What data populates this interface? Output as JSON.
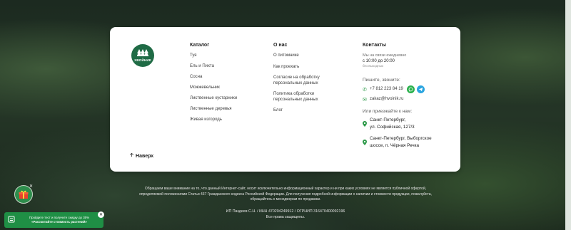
{
  "logo": {
    "text": "ХВОЙНИК",
    "color": "#1f6b45"
  },
  "catalog": {
    "title": "Каталог",
    "items": [
      "Туя",
      "Ель и Пихта",
      "Сосна",
      "Можжевельник",
      "Лиственные кустарники",
      "Лиственные деревья",
      "Живая изгородь"
    ]
  },
  "about": {
    "title": "О нас",
    "items": [
      "О питомнике",
      "Как проехать",
      "Согласие на обработку персональных данных",
      "Политика обработки персональных данных",
      "Блог"
    ]
  },
  "contacts": {
    "title": "Контакты",
    "hours_label": "Мы на связи ежедневно",
    "hours": "с 10:00 до 20:00",
    "no_days_off": "без выходных",
    "write_call_label": "Пишите, звоните:",
    "phone": "+7 812 223 84 19",
    "email": "zakaz@hvoinik.ru",
    "visit_label": "Или приезжайте к нам:",
    "addresses": [
      {
        "line1": "Санкт-Петербург,",
        "line2": "ул. Софийская, 127/3"
      },
      {
        "line1": "Санкт-Петербург, Выборгское",
        "line2": "шоссе, п. Чёрная Речка"
      }
    ]
  },
  "back_to_top": "Наверх",
  "disclaimer": "Обращаем ваше внимание на то, что данный Интернет-сайт, носит исключительно информационный характер и ни при каких условиях не является публичной офертой, определяемой положениями Статьи 437 Гражданского кодекса Российской Федерации. Для получения подробной информации о наличии и стоимости продукции, пожалуйста, обращайтесь к менеджерам по продажам.",
  "legal": {
    "line1": "ИП Паздеев С.Н. / ИНН 470204249912 / ОГРНИП 316470400092196",
    "line2": "Все права защищены."
  },
  "promo": {
    "line1": "Пройдите тест и получите скидку до 35%",
    "line2": "«Рассчитайте стоимость растений»"
  },
  "colors": {
    "accent": "#2e9a4a",
    "whatsapp": "#2bb14d",
    "telegram": "#2ba5e0",
    "promo": "#1f8f45"
  }
}
